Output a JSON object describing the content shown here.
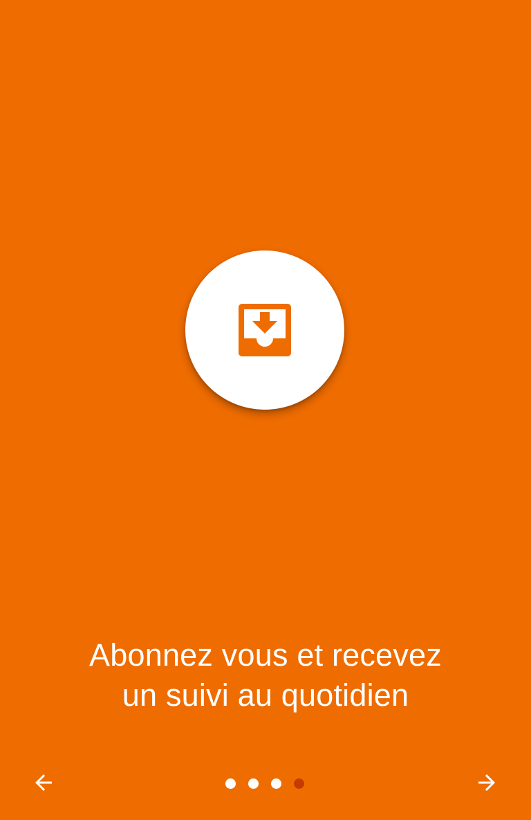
{
  "screen": {
    "background_color": "#EF6C00",
    "accent_color": "#EF6C00",
    "active_dot_color": "#C63A00",
    "inactive_dot_color": "#FFFFFF"
  },
  "hero": {
    "icon": "inbox-download-icon"
  },
  "caption": {
    "line1": "Abonnez vous et recevez",
    "line2": "un suivi au quotidien"
  },
  "navigation": {
    "prev_icon": "arrow-left-icon",
    "next_icon": "arrow-right-icon",
    "page_count": 4,
    "current_page": 4
  }
}
